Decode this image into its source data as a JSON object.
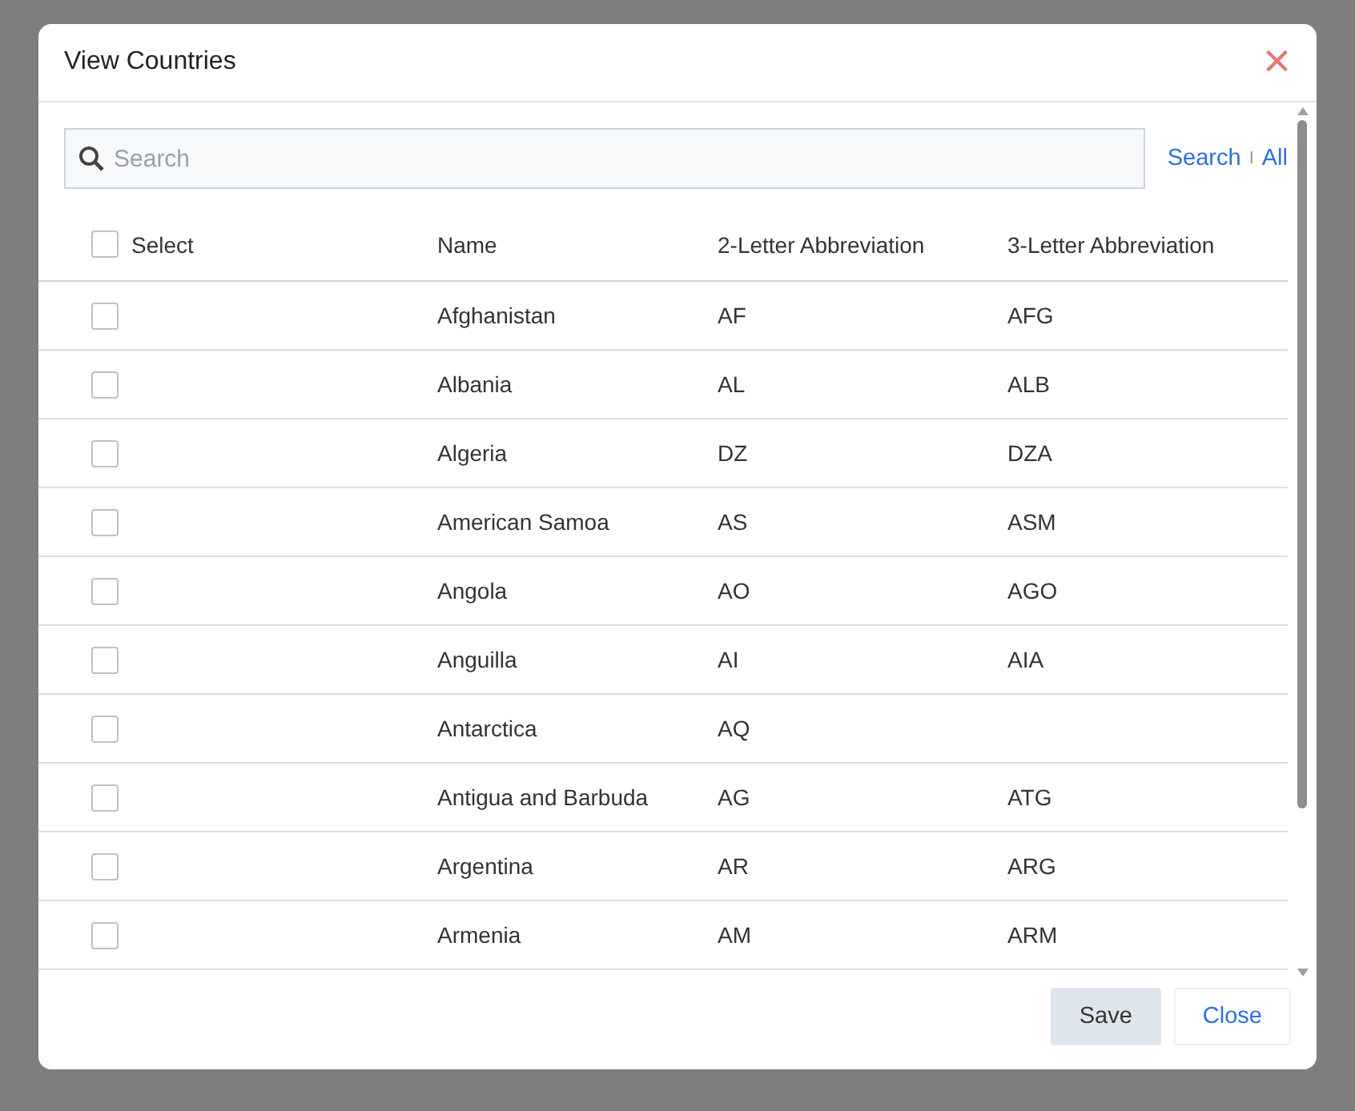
{
  "dialog": {
    "title": "View Countries",
    "close_symbol": "×"
  },
  "search": {
    "placeholder": "Search",
    "search_link": "Search",
    "separator": "I",
    "all_link": "All"
  },
  "table": {
    "select_header": "Select",
    "select_all_checked": false,
    "columns": [
      "Name",
      "2-Letter Abbreviation",
      "3-Letter Abbreviation"
    ],
    "rows": [
      {
        "checked": false,
        "cells": [
          "Afghanistan",
          "AF",
          "AFG"
        ]
      },
      {
        "checked": false,
        "cells": [
          "Albania",
          "AL",
          "ALB"
        ]
      },
      {
        "checked": false,
        "cells": [
          "Algeria",
          "DZ",
          "DZA"
        ]
      },
      {
        "checked": false,
        "cells": [
          "American Samoa",
          "AS",
          "ASM"
        ]
      },
      {
        "checked": false,
        "cells": [
          "Angola",
          "AO",
          "AGO"
        ]
      },
      {
        "checked": false,
        "cells": [
          "Anguilla",
          "AI",
          "AIA"
        ]
      },
      {
        "checked": false,
        "cells": [
          "Antarctica",
          "AQ",
          ""
        ]
      },
      {
        "checked": false,
        "cells": [
          "Antigua and Barbuda",
          "AG",
          "ATG"
        ]
      },
      {
        "checked": false,
        "cells": [
          "Argentina",
          "AR",
          "ARG"
        ]
      },
      {
        "checked": false,
        "cells": [
          "Armenia",
          "AM",
          "ARM"
        ]
      }
    ]
  },
  "buttons": [
    {
      "label": "Save",
      "kind": "primary"
    },
    {
      "label": "Close",
      "kind": "link"
    }
  ]
}
